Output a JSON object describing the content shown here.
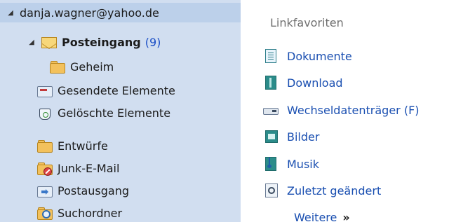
{
  "mail_tree": {
    "account": {
      "expander_glyph": "◢",
      "label": "danja.wagner@yahoo.de"
    },
    "folders": [
      {
        "label": "Posteingang",
        "count": "(9)",
        "icon": "inbox-envelope-icon",
        "expander_glyph": "◢"
      },
      {
        "label": "Geheim",
        "icon": "folder-icon"
      },
      {
        "label": "Gesendete Elemente",
        "icon": "sent-items-icon"
      },
      {
        "label": "Gelöschte Elemente",
        "icon": "deleted-items-icon"
      },
      {
        "label": "Entwürfe",
        "icon": "drafts-folder-icon"
      },
      {
        "label": "Junk-E-Mail",
        "icon": "junk-email-icon"
      },
      {
        "label": "Postausgang",
        "icon": "outbox-icon"
      },
      {
        "label": "Suchordner",
        "icon": "search-folder-icon"
      }
    ]
  },
  "link_favorites": {
    "header": "Linkfavoriten",
    "items": [
      {
        "label": "Dokumente",
        "icon": "documents-icon"
      },
      {
        "label": "Download",
        "icon": "download-icon"
      },
      {
        "label": "Wechseldatenträger (F)",
        "icon": "removable-drive-icon"
      },
      {
        "label": "Bilder",
        "icon": "pictures-icon"
      },
      {
        "label": "Musik",
        "icon": "music-icon"
      },
      {
        "label": "Zuletzt geändert",
        "icon": "recent-icon"
      }
    ],
    "more": {
      "label": "Weitere",
      "chevrons": "»"
    }
  }
}
